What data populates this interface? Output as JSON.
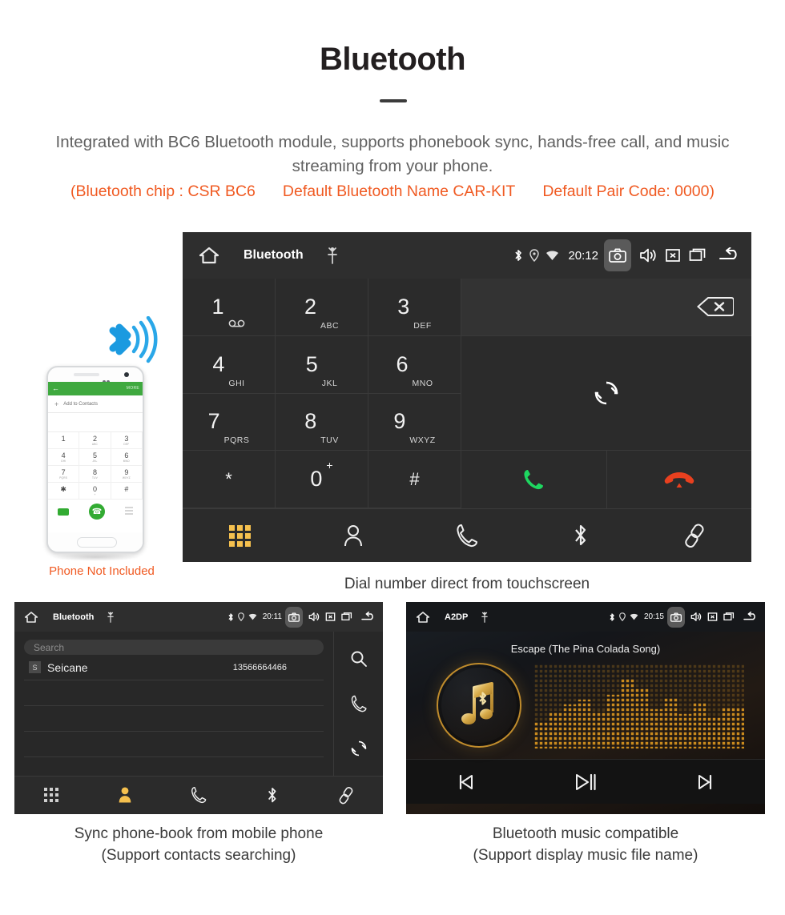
{
  "header": {
    "title": "Bluetooth",
    "description": "Integrated with BC6 Bluetooth module, supports phonebook sync, hands-free call, and music streaming from your phone.",
    "specs": [
      "(Bluetooth chip : CSR BC6",
      "Default Bluetooth Name CAR-KIT",
      "Default Pair Code: 0000)"
    ]
  },
  "colors": {
    "accent_orange": "#f05a22",
    "key_active": "#f5c04e",
    "call_green": "#1ed760",
    "hangup_red": "#e8401f",
    "bluetooth_blue": "#20a4e8",
    "gold": "#c08c2c"
  },
  "phone_mock": {
    "caption": "Phone Not Included",
    "appbar_more": "MORE",
    "add_to_contacts": "Add to Contacts",
    "keys": [
      {
        "num": "1",
        "sub": ""
      },
      {
        "num": "2",
        "sub": "ABC"
      },
      {
        "num": "3",
        "sub": "DEF"
      },
      {
        "num": "4",
        "sub": "GHI"
      },
      {
        "num": "5",
        "sub": "JKL"
      },
      {
        "num": "6",
        "sub": "MNO"
      },
      {
        "num": "7",
        "sub": "PQRS"
      },
      {
        "num": "8",
        "sub": "TUV"
      },
      {
        "num": "9",
        "sub": "WXYZ"
      },
      {
        "num": "*",
        "sub": ""
      },
      {
        "num": "0",
        "sub": "+"
      },
      {
        "num": "#",
        "sub": ""
      }
    ]
  },
  "dialer": {
    "statusbar": {
      "title": "Bluetooth",
      "time": "20:12",
      "icons": [
        "home-icon",
        "usb-icon",
        "bluetooth-icon",
        "location-icon",
        "wifi-icon",
        "camera-icon",
        "volume-icon",
        "close-box-icon",
        "recents-icon",
        "back-icon"
      ]
    },
    "keys": [
      {
        "num": "1",
        "sub": "∞"
      },
      {
        "num": "2",
        "sub": "ABC"
      },
      {
        "num": "3",
        "sub": "DEF"
      },
      {
        "num": "4",
        "sub": "GHI"
      },
      {
        "num": "5",
        "sub": "JKL"
      },
      {
        "num": "6",
        "sub": "MNO"
      },
      {
        "num": "7",
        "sub": "PQRS"
      },
      {
        "num": "8",
        "sub": "TUV"
      },
      {
        "num": "9",
        "sub": "WXYZ"
      },
      {
        "num": "*",
        "sub": ""
      },
      {
        "num": "0",
        "sub": "+"
      },
      {
        "num": "#",
        "sub": ""
      }
    ],
    "number_display": "",
    "nav": [
      "keypad-icon",
      "contacts-icon",
      "calllog-icon",
      "bluetooth-icon",
      "link-icon"
    ],
    "active_nav": "keypad-icon",
    "caption": "Dial number direct from touchscreen"
  },
  "phonebook": {
    "statusbar": {
      "title": "Bluetooth",
      "time": "20:11"
    },
    "search_placeholder": "Search",
    "contacts": [
      {
        "initial": "S",
        "name": "Seicane",
        "number": "13566664466"
      }
    ],
    "side_icons": [
      "search-icon",
      "call-icon",
      "sync-icon"
    ],
    "nav": [
      "keypad-icon",
      "contacts-icon",
      "calllog-icon",
      "bluetooth-icon",
      "link-icon"
    ],
    "active_nav": "contacts-icon",
    "caption_line1": "Sync phone-book from mobile phone",
    "caption_line2": "(Support contacts searching)"
  },
  "a2dp": {
    "statusbar": {
      "title": "A2DP",
      "time": "20:15"
    },
    "song_title": "Escape (The Pina Colada Song)",
    "controls": [
      "previous-icon",
      "play-pause-icon",
      "next-icon"
    ],
    "caption_line1": "Bluetooth music compatible",
    "caption_line2": "(Support display music file name)"
  }
}
